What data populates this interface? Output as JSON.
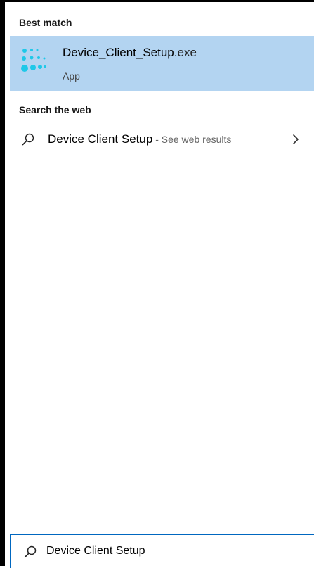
{
  "colors": {
    "selection_bg": "#b3d4f1",
    "app_icon": "#1ec8e8",
    "search_box_border": "#0067c0"
  },
  "best_match": {
    "header": "Best match",
    "item": {
      "name": "Device_Client_Setup",
      "extension": ".exe",
      "type": "App",
      "icon": "app-dots-icon"
    }
  },
  "web": {
    "header": "Search the web",
    "item": {
      "query": "Device Client Setup",
      "hint": " - See web results",
      "icon": "search-icon",
      "trailing_icon": "chevron-right-icon"
    }
  },
  "search_box": {
    "value": "Device Client Setup",
    "icon": "search-icon"
  }
}
